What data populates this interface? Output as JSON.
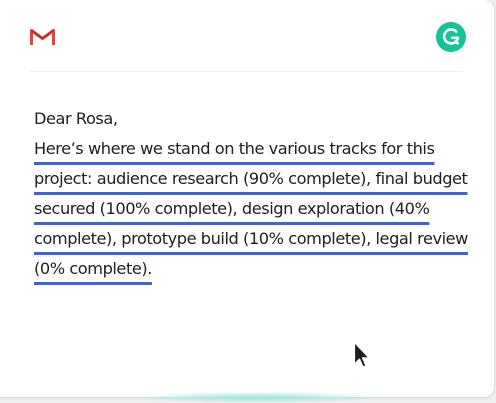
{
  "icons": {
    "gmail": "gmail-icon",
    "grammarly": "grammarly-icon",
    "cursor": "mouse-pointer-icon"
  },
  "colors": {
    "grammarly_green": "#15c39a",
    "underline_blue": "#3d63d4",
    "gmail_red": "#ea4335"
  },
  "email": {
    "greeting": "Dear Rosa,",
    "body": "Here’s where we stand on the various tracks for this project: audience research (90% complete), final budget secured (100% complete), design exploration (40% complete), prototype build (10% complete), legal review (0% complete)."
  }
}
